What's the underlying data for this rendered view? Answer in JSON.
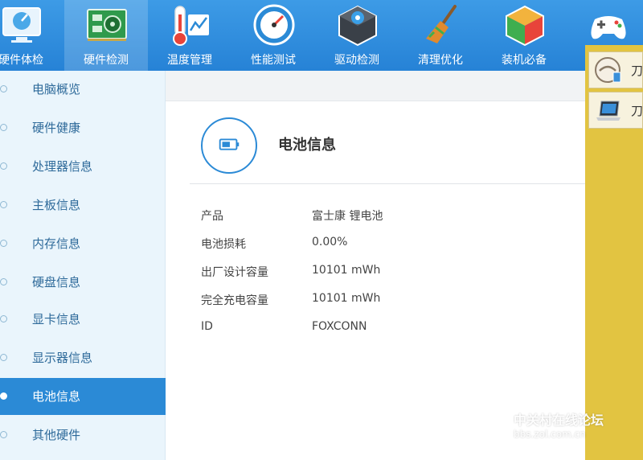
{
  "toolbar": {
    "items": [
      {
        "label": "硬件体检",
        "icon": "monitor-check-icon"
      },
      {
        "label": "硬件检测",
        "icon": "circuit-board-icon"
      },
      {
        "label": "温度管理",
        "icon": "thermometer-icon"
      },
      {
        "label": "性能测试",
        "icon": "speedometer-icon"
      },
      {
        "label": "驱动检测",
        "icon": "gear-box-icon"
      },
      {
        "label": "清理优化",
        "icon": "broom-icon"
      },
      {
        "label": "装机必备",
        "icon": "cube-icon"
      },
      {
        "label": "",
        "icon": "gamepad-icon"
      }
    ],
    "active_index": 1
  },
  "sidebar": {
    "items": [
      {
        "label": "电脑概览"
      },
      {
        "label": "硬件健康"
      },
      {
        "label": "处理器信息"
      },
      {
        "label": "主板信息"
      },
      {
        "label": "内存信息"
      },
      {
        "label": "硬盘信息"
      },
      {
        "label": "显卡信息"
      },
      {
        "label": "显示器信息"
      },
      {
        "label": "电池信息"
      },
      {
        "label": "其他硬件"
      }
    ],
    "active_index": 8
  },
  "main": {
    "title": "电池信息",
    "icon": "battery-icon",
    "rows": [
      {
        "key": "产品",
        "value": "富士康 锂电池"
      },
      {
        "key": "电池损耗",
        "value": "0.00%"
      },
      {
        "key": "出厂设计容量",
        "value": "10101 mWh"
      },
      {
        "key": "完全充电容量",
        "value": "10101 mWh"
      },
      {
        "key": "ID",
        "value": "FOXCONN"
      }
    ]
  },
  "right_panel": {
    "items": [
      {
        "label": "刀",
        "icon": "blade-app-icon"
      },
      {
        "label": "刀",
        "icon": "laptop-app-icon"
      }
    ]
  },
  "watermark": {
    "line1": "中关村在线论坛",
    "line2": "bbs.zol.com.cn"
  },
  "colors": {
    "toolbar_blue": "#2682d6",
    "accent_blue": "#2b8ad6",
    "sidebar_bg": "#eaf5fc",
    "right_panel": "#e2c441"
  }
}
